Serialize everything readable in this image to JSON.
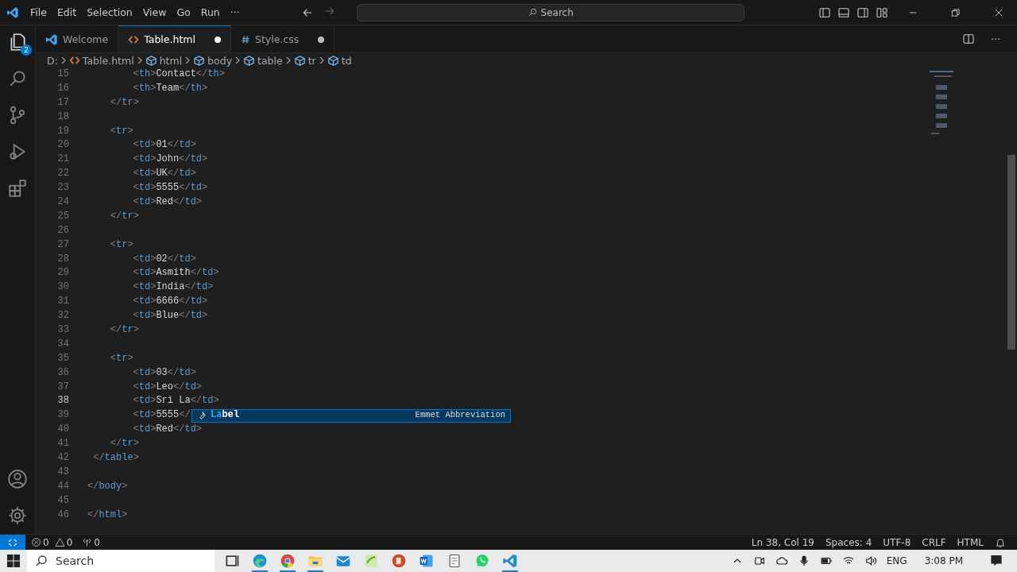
{
  "menu": [
    "File",
    "Edit",
    "Selection",
    "View",
    "Go",
    "Run",
    "···"
  ],
  "search": {
    "placeholder": "Search"
  },
  "activity_bar": {
    "items": [
      {
        "kind": "explorer",
        "badge": "2"
      },
      {
        "kind": "search"
      },
      {
        "kind": "source-control"
      },
      {
        "kind": "run"
      },
      {
        "kind": "extensions"
      }
    ],
    "bottom": [
      {
        "kind": "account"
      },
      {
        "kind": "settings"
      }
    ]
  },
  "tabs": [
    {
      "label": "Welcome",
      "kind": "welcome",
      "selected": false,
      "modified": false
    },
    {
      "label": "Table.html",
      "kind": "html",
      "selected": true,
      "modified": true
    },
    {
      "label": "Style.css",
      "kind": "css",
      "selected": false,
      "modified": true
    }
  ],
  "editor_actions": {
    "more": "···"
  },
  "breadcrumb": [
    {
      "label": "D:",
      "kind": "drive"
    },
    {
      "label": "Table.html",
      "kind": "html"
    },
    {
      "label": "html",
      "kind": "element"
    },
    {
      "label": "body",
      "kind": "element"
    },
    {
      "label": "table",
      "kind": "element"
    },
    {
      "label": "tr",
      "kind": "element"
    },
    {
      "label": "td",
      "kind": "element"
    }
  ],
  "editor": {
    "lines": [
      {
        "number": "15",
        "text": "        <th>Contact</th>",
        "current": false
      },
      {
        "number": "16",
        "text": "        <th>Team</th>",
        "current": false
      },
      {
        "number": "17",
        "text": "    </tr>",
        "current": false
      },
      {
        "number": "18",
        "current": false
      },
      {
        "number": "19",
        "text": "    <tr>",
        "current": false
      },
      {
        "number": "20",
        "text": "        <td>01</td>",
        "current": false
      },
      {
        "number": "21",
        "text": "        <td>John</td>",
        "current": false
      },
      {
        "number": "22",
        "text": "        <td>UK</td>",
        "current": false
      },
      {
        "number": "23",
        "text": "        <td>5555</td>",
        "current": false
      },
      {
        "number": "24",
        "text": "        <td>Red</td>",
        "current": false
      },
      {
        "number": "25",
        "text": "    </tr>",
        "current": false
      },
      {
        "number": "26",
        "current": false
      },
      {
        "number": "27",
        "text": "    <tr>",
        "current": false
      },
      {
        "number": "28",
        "text": "        <td>02</td>",
        "current": false
      },
      {
        "number": "29",
        "text": "        <td>Asmith</td>",
        "current": false
      },
      {
        "number": "30",
        "text": "        <td>India</td>",
        "current": false
      },
      {
        "number": "31",
        "text": "        <td>6666</td>",
        "current": false
      },
      {
        "number": "32",
        "text": "        <td>Blue</td>",
        "current": false
      },
      {
        "number": "33",
        "text": "    </tr>",
        "current": false
      },
      {
        "number": "34",
        "current": false
      },
      {
        "number": "35",
        "text": "    <tr>",
        "current": false
      },
      {
        "number": "36",
        "text": "        <td>03</td>",
        "current": false
      },
      {
        "number": "37",
        "text": "        <td>Leo</td>",
        "current": false
      },
      {
        "number": "38",
        "text": "        <td>Sri La</td>",
        "current": true
      },
      {
        "number": "39",
        "text": "        <td>5555</",
        "current": false
      },
      {
        "number": "40",
        "text": "        <td>Red</td>",
        "current": false
      },
      {
        "number": "41",
        "text": "    </tr>",
        "current": false
      },
      {
        "number": "42",
        "text": " </table>",
        "current": false
      },
      {
        "number": "43",
        "current": false
      },
      {
        "number": "44",
        "text": "</body>",
        "current": false
      },
      {
        "number": "45",
        "current": false
      },
      {
        "number": "46",
        "text": "</html>",
        "current": false
      }
    ],
    "suggestion": {
      "label": "**La**bel",
      "detail": "Emmet Abbreviation"
    }
  },
  "status_bar": {
    "errors": "0",
    "warnings": "0",
    "ports": "0",
    "right": [
      "Ln 38, Col 19",
      "Spaces: 4",
      "UTF-8",
      "CRLF",
      "HTML"
    ]
  },
  "taskbar": {
    "search": {
      "placeholder": "Search"
    },
    "apps": [
      {
        "kind": "task-view",
        "running": false
      },
      {
        "kind": "edge",
        "running": true
      },
      {
        "kind": "chrome",
        "running": true
      },
      {
        "kind": "folder",
        "running": true
      },
      {
        "kind": "mail",
        "running": false
      },
      {
        "kind": "sheet",
        "running": false
      },
      {
        "kind": "slides",
        "running": false
      },
      {
        "kind": "word",
        "running": false
      },
      {
        "kind": "notepad",
        "running": false
      },
      {
        "kind": "chat",
        "running": false
      },
      {
        "kind": "vscode",
        "running": true
      }
    ],
    "language": "ENG",
    "time": "3:08 PM"
  }
}
